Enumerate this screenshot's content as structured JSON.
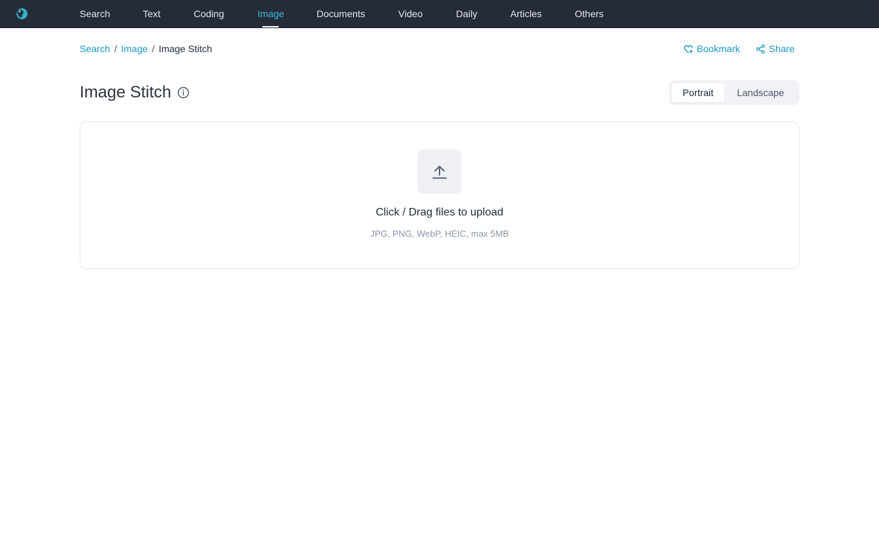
{
  "nav": {
    "logo_icon": "app-logo",
    "items": [
      {
        "label": "Search"
      },
      {
        "label": "Text"
      },
      {
        "label": "Coding"
      },
      {
        "label": "Image"
      },
      {
        "label": "Documents"
      },
      {
        "label": "Video"
      },
      {
        "label": "Daily"
      },
      {
        "label": "Articles"
      },
      {
        "label": "Others"
      }
    ],
    "active": "Image"
  },
  "breadcrumb": {
    "items": [
      "Search",
      "Image",
      "Image Stitch"
    ],
    "separator": "/"
  },
  "actions": {
    "bookmark_label": "Bookmark",
    "share_label": "Share"
  },
  "page": {
    "title": "Image Stitch"
  },
  "orientation": {
    "options": [
      "Portrait",
      "Landscape"
    ],
    "selected": "Portrait"
  },
  "upload": {
    "label": "Click / Drag files to upload",
    "hint": "JPG, PNG, WebP, HEIC, max 5MB"
  },
  "colors": {
    "topbar": "#252b37",
    "accent": "#1a97c2",
    "nav_active": "#3bbde0"
  }
}
